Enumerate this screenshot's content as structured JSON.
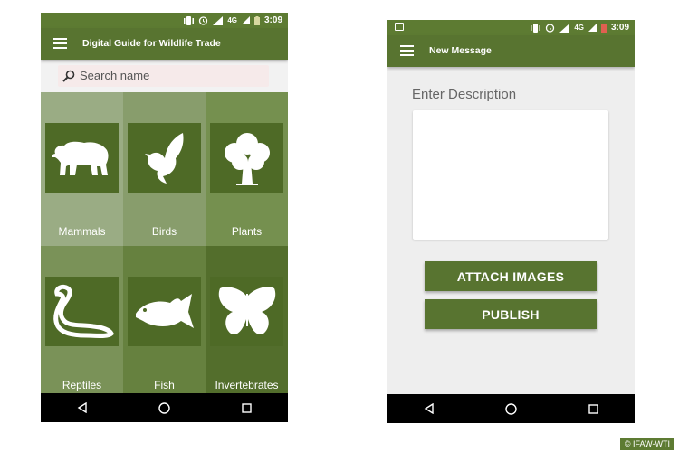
{
  "status_bar": {
    "network": "4G",
    "time": "3:09"
  },
  "left_screen": {
    "app_title": "Digital Guide for Wildlife Trade",
    "search": {
      "placeholder": "Search name"
    },
    "categories": [
      {
        "label": "Mammals",
        "icon": "polar-bear-icon",
        "bg": "#9aac84"
      },
      {
        "label": "Birds",
        "icon": "dove-icon",
        "bg": "#889d6c"
      },
      {
        "label": "Plants",
        "icon": "tree-icon",
        "bg": "#75904f"
      },
      {
        "label": "Reptiles",
        "icon": "snake-icon",
        "bg": "#7a9258"
      },
      {
        "label": "Fish",
        "icon": "fish-icon",
        "bg": "#66813f"
      },
      {
        "label": "Invertebrates",
        "icon": "butterfly-icon",
        "bg": "#536e2c"
      }
    ]
  },
  "right_screen": {
    "app_title": "New Message",
    "description_label": "Enter Description",
    "buttons": {
      "attach": "ATTACH IMAGES",
      "publish": "PUBLISH"
    }
  },
  "colors": {
    "primary": "#587430",
    "status": "#5d7b32",
    "tile_icon": "#4e6a26"
  },
  "watermark": "© IFAW-WTI"
}
